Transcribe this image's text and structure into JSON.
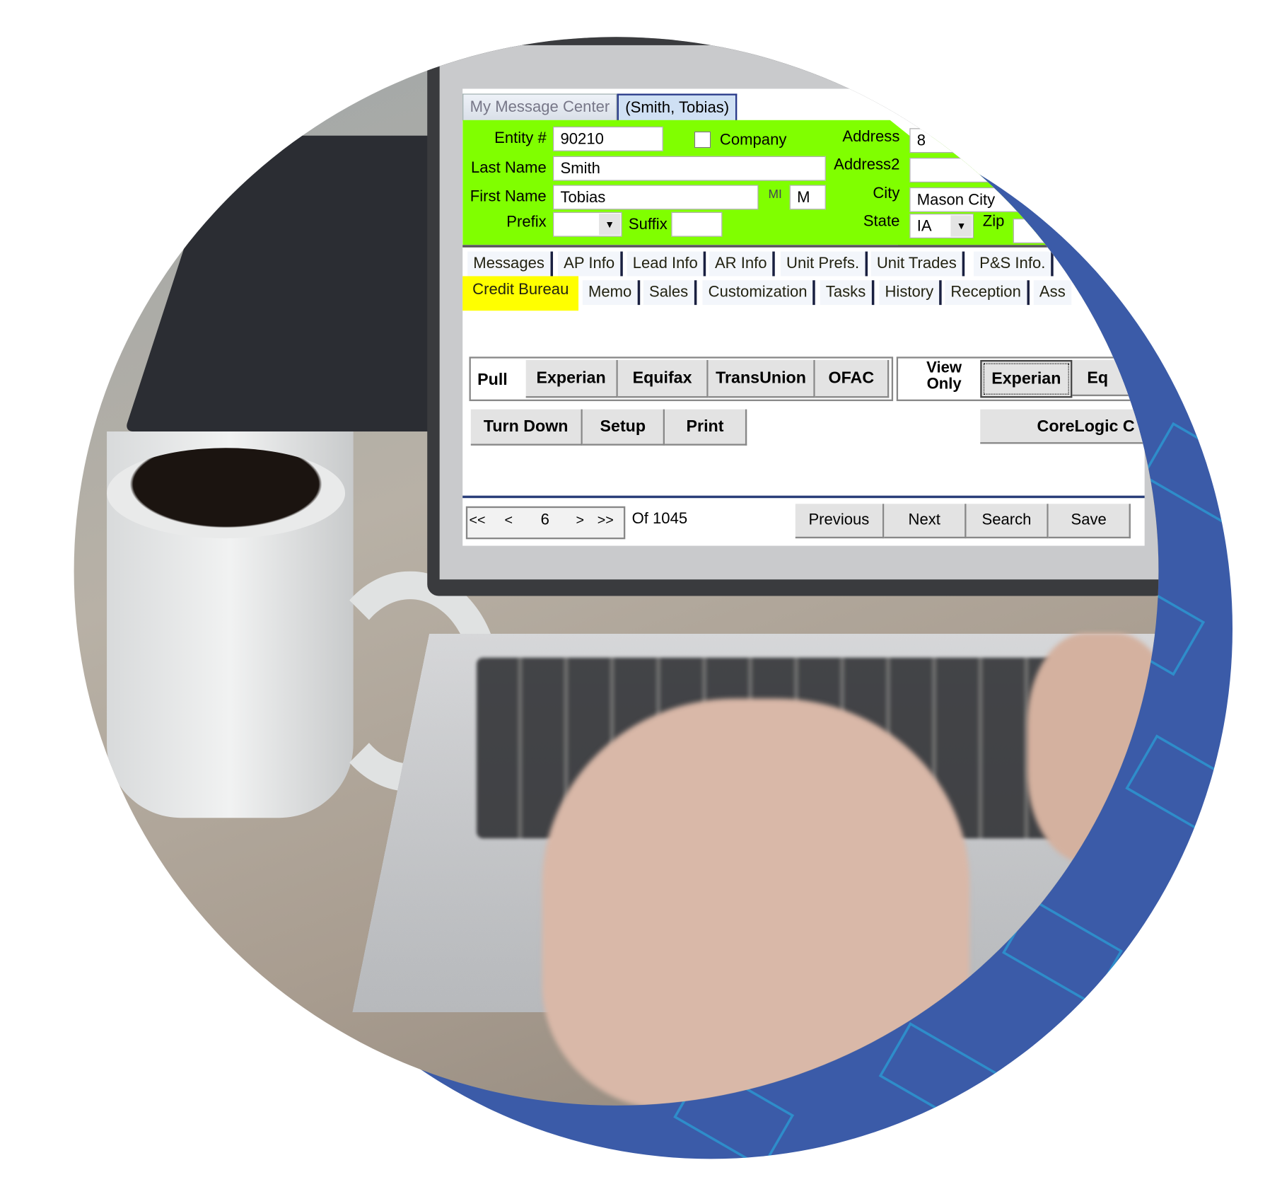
{
  "window_tabs": [
    "My Message Center",
    "(Smith, Tobias)"
  ],
  "form": {
    "entity_label": "Entity #",
    "entity_value": "90210",
    "company_label": "Company",
    "company_checked": false,
    "last_name_label": "Last Name",
    "last_name_value": "Smith",
    "first_name_label": "First Name",
    "first_name_value": "Tobias",
    "mi_label": "MI",
    "mi_value": "M",
    "prefix_label": "Prefix",
    "prefix_value": "",
    "suffix_label": "Suffix",
    "suffix_value": "",
    "address_label": "Address",
    "address_value": "8",
    "address2_label": "Address2",
    "address2_value": "",
    "city_label": "City",
    "city_value": "Mason City",
    "state_label": "State",
    "state_value": "IA",
    "zip_label": "Zip",
    "zip_value": ""
  },
  "nav_tabs_row1": [
    "Messages",
    "AP Info",
    "Lead Info",
    "AR Info",
    "Unit Prefs.",
    "Unit Trades",
    "P&S Info."
  ],
  "nav_tabs_row2": [
    "Credit Bureau",
    "Memo",
    "Sales",
    "Customization",
    "Tasks",
    "History",
    "Reception",
    "Ass"
  ],
  "active_tab": "Credit Bureau",
  "credit": {
    "pull_label": "Pull",
    "pull_buttons": [
      "Experian",
      "Equifax",
      "TransUnion",
      "OFAC"
    ],
    "view_only_label": "View Only",
    "view_buttons": [
      "Experian",
      "Eq"
    ],
    "actions": [
      "Turn Down",
      "Setup",
      "Print"
    ],
    "corelogic": "CoreLogic C"
  },
  "pager": {
    "first": "<<",
    "prev": "<",
    "page": "6",
    "next": ">",
    "last": ">>",
    "of": "Of 1045"
  },
  "footer_buttons": [
    "Previous",
    "Next",
    "Search",
    "Save"
  ],
  "colors": {
    "header_green": "#80ff00",
    "active_tab_yellow": "#ffff00",
    "ring_blue": "#3b5ba8",
    "hex_lines": "#2aa3d9"
  }
}
